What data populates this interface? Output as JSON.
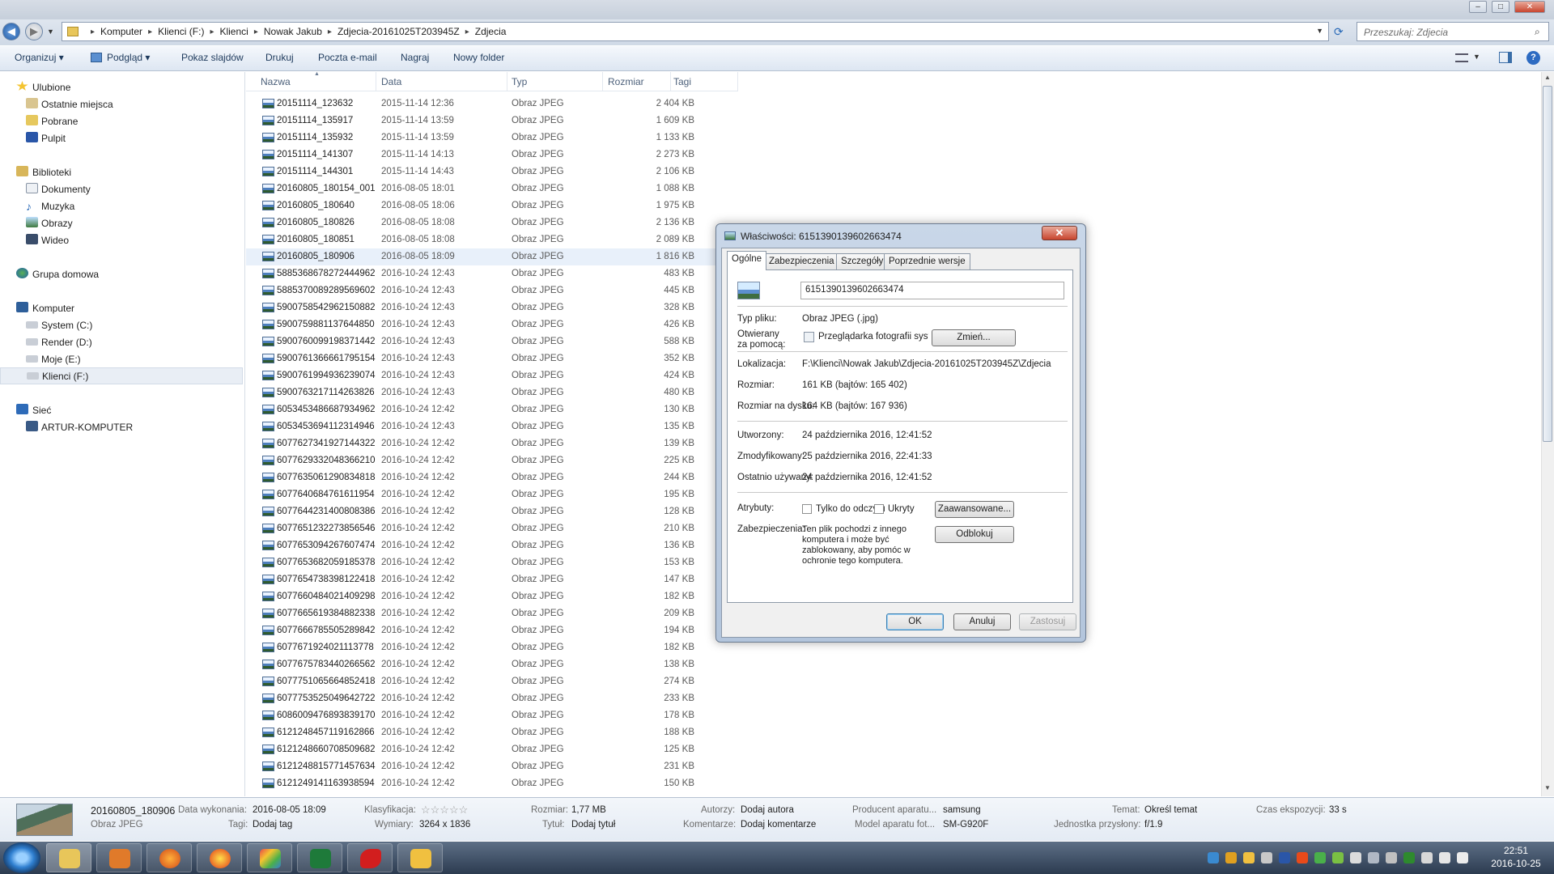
{
  "window": {
    "minimize": "–",
    "maximize": "□",
    "close": "✕"
  },
  "address": {
    "breadcrumbs": [
      "Komputer",
      "Klienci (F:)",
      "Klienci",
      "Nowak Jakub",
      "Zdjecia-20161025T203945Z",
      "Zdjecia"
    ],
    "separator": "▸",
    "search_placeholder": "Przeszukaj: Zdjecia"
  },
  "toolbar": {
    "organize": "Organizuj ▾",
    "preview": "Podgląd ▾",
    "slideshow": "Pokaz slajdów",
    "print": "Drukuj",
    "email": "Poczta e-mail",
    "burn": "Nagraj",
    "new_folder": "Nowy folder"
  },
  "nav": {
    "favorites": "Ulubione",
    "recent": "Ostatnie miejsca",
    "downloads": "Pobrane",
    "desktop": "Pulpit",
    "libraries": "Biblioteki",
    "documents": "Dokumenty",
    "music": "Muzyka",
    "pictures": "Obrazy",
    "videos": "Wideo",
    "homegroup": "Grupa domowa",
    "computer": "Komputer",
    "drive_c": "System (C:)",
    "drive_d": "Render (D:)",
    "drive_e": "Moje (E:)",
    "drive_f": "Klienci (F:)",
    "network": "Sieć",
    "pc": "ARTUR-KOMPUTER"
  },
  "columns": {
    "name": "Nazwa",
    "date": "Data",
    "type": "Typ",
    "size": "Rozmiar",
    "tags": "Tagi"
  },
  "files": [
    {
      "name": "20151114_123632",
      "date": "2015-11-14 12:36",
      "type": "Obraz JPEG",
      "size": "2 404 KB"
    },
    {
      "name": "20151114_135917",
      "date": "2015-11-14 13:59",
      "type": "Obraz JPEG",
      "size": "1 609 KB"
    },
    {
      "name": "20151114_135932",
      "date": "2015-11-14 13:59",
      "type": "Obraz JPEG",
      "size": "1 133 KB"
    },
    {
      "name": "20151114_141307",
      "date": "2015-11-14 14:13",
      "type": "Obraz JPEG",
      "size": "2 273 KB"
    },
    {
      "name": "20151114_144301",
      "date": "2015-11-14 14:43",
      "type": "Obraz JPEG",
      "size": "2 106 KB"
    },
    {
      "name": "20160805_180154_001",
      "date": "2016-08-05 18:01",
      "type": "Obraz JPEG",
      "size": "1 088 KB"
    },
    {
      "name": "20160805_180640",
      "date": "2016-08-05 18:06",
      "type": "Obraz JPEG",
      "size": "1 975 KB"
    },
    {
      "name": "20160805_180826",
      "date": "2016-08-05 18:08",
      "type": "Obraz JPEG",
      "size": "2 136 KB"
    },
    {
      "name": "20160805_180851",
      "date": "2016-08-05 18:08",
      "type": "Obraz JPEG",
      "size": "2 089 KB"
    },
    {
      "name": "20160805_180906",
      "date": "2016-08-05 18:09",
      "type": "Obraz JPEG",
      "size": "1 816 KB"
    },
    {
      "name": "5885368678272444962",
      "date": "2016-10-24 12:43",
      "type": "Obraz JPEG",
      "size": "483 KB"
    },
    {
      "name": "5885370089289569602",
      "date": "2016-10-24 12:43",
      "type": "Obraz JPEG",
      "size": "445 KB"
    },
    {
      "name": "5900758542962150882",
      "date": "2016-10-24 12:43",
      "type": "Obraz JPEG",
      "size": "328 KB"
    },
    {
      "name": "5900759881137644850",
      "date": "2016-10-24 12:43",
      "type": "Obraz JPEG",
      "size": "426 KB"
    },
    {
      "name": "5900760099198371442",
      "date": "2016-10-24 12:43",
      "type": "Obraz JPEG",
      "size": "588 KB"
    },
    {
      "name": "5900761366661795154",
      "date": "2016-10-24 12:43",
      "type": "Obraz JPEG",
      "size": "352 KB"
    },
    {
      "name": "5900761994936239074",
      "date": "2016-10-24 12:43",
      "type": "Obraz JPEG",
      "size": "424 KB"
    },
    {
      "name": "5900763217114263826",
      "date": "2016-10-24 12:43",
      "type": "Obraz JPEG",
      "size": "480 KB"
    },
    {
      "name": "6053453486687934962",
      "date": "2016-10-24 12:42",
      "type": "Obraz JPEG",
      "size": "130 KB"
    },
    {
      "name": "6053453694112314946",
      "date": "2016-10-24 12:43",
      "type": "Obraz JPEG",
      "size": "135 KB"
    },
    {
      "name": "6077627341927144322",
      "date": "2016-10-24 12:42",
      "type": "Obraz JPEG",
      "size": "139 KB"
    },
    {
      "name": "6077629332048366210",
      "date": "2016-10-24 12:42",
      "type": "Obraz JPEG",
      "size": "225 KB"
    },
    {
      "name": "6077635061290834818",
      "date": "2016-10-24 12:42",
      "type": "Obraz JPEG",
      "size": "244 KB"
    },
    {
      "name": "6077640684761611954",
      "date": "2016-10-24 12:42",
      "type": "Obraz JPEG",
      "size": "195 KB"
    },
    {
      "name": "6077644231400808386",
      "date": "2016-10-24 12:42",
      "type": "Obraz JPEG",
      "size": "128 KB"
    },
    {
      "name": "6077651232273856546",
      "date": "2016-10-24 12:42",
      "type": "Obraz JPEG",
      "size": "210 KB"
    },
    {
      "name": "6077653094267607474",
      "date": "2016-10-24 12:42",
      "type": "Obraz JPEG",
      "size": "136 KB"
    },
    {
      "name": "6077653682059185378",
      "date": "2016-10-24 12:42",
      "type": "Obraz JPEG",
      "size": "153 KB"
    },
    {
      "name": "6077654738398122418",
      "date": "2016-10-24 12:42",
      "type": "Obraz JPEG",
      "size": "147 KB"
    },
    {
      "name": "6077660484021409298",
      "date": "2016-10-24 12:42",
      "type": "Obraz JPEG",
      "size": "182 KB"
    },
    {
      "name": "6077665619384882338",
      "date": "2016-10-24 12:42",
      "type": "Obraz JPEG",
      "size": "209 KB"
    },
    {
      "name": "6077666785505289842",
      "date": "2016-10-24 12:42",
      "type": "Obraz JPEG",
      "size": "194 KB"
    },
    {
      "name": "6077671924021113778",
      "date": "2016-10-24 12:42",
      "type": "Obraz JPEG",
      "size": "182 KB"
    },
    {
      "name": "6077675783440266562",
      "date": "2016-10-24 12:42",
      "type": "Obraz JPEG",
      "size": "138 KB"
    },
    {
      "name": "6077751065664852418",
      "date": "2016-10-24 12:42",
      "type": "Obraz JPEG",
      "size": "274 KB"
    },
    {
      "name": "6077753525049642722",
      "date": "2016-10-24 12:42",
      "type": "Obraz JPEG",
      "size": "233 KB"
    },
    {
      "name": "6086009476893839170",
      "date": "2016-10-24 12:42",
      "type": "Obraz JPEG",
      "size": "178 KB"
    },
    {
      "name": "6121248457119162866",
      "date": "2016-10-24 12:42",
      "type": "Obraz JPEG",
      "size": "188 KB"
    },
    {
      "name": "6121248660708509682",
      "date": "2016-10-24 12:42",
      "type": "Obraz JPEG",
      "size": "125 KB"
    },
    {
      "name": "6121248815771457634",
      "date": "2016-10-24 12:42",
      "type": "Obraz JPEG",
      "size": "231 KB"
    },
    {
      "name": "6121249141163938594",
      "date": "2016-10-24 12:42",
      "type": "Obraz JPEG",
      "size": "150 KB"
    }
  ],
  "dialog": {
    "title": "Właściwości: 6151390139602663474",
    "close": "✕",
    "tabs": [
      "Ogólne",
      "Zabezpieczenia",
      "Szczegóły",
      "Poprzednie wersje"
    ],
    "filename": "6151390139602663474",
    "file_type_label": "Typ pliku:",
    "file_type_value": "Obraz JPEG (.jpg)",
    "opens_with_label_1": "Otwierany",
    "opens_with_label_2": "za pomocą:",
    "opens_with_value": "Przeglądarka fotografii systemu Wir",
    "change_button": "Zmień...",
    "location_label": "Lokalizacja:",
    "location_value": "F:\\Klienci\\Nowak Jakub\\Zdjecia-20161025T203945Z\\Zdjecia",
    "size_label": "Rozmiar:",
    "size_value": "161 KB (bajtów: 165 402)",
    "disk_size_label": "Rozmiar na dysku:",
    "disk_size_value": "164 KB (bajtów: 167 936)",
    "created_label": "Utworzony:",
    "created_value": "24 października 2016, 12:41:52",
    "modified_label": "Zmodyfikowany:",
    "modified_value": "25 października 2016, 22:41:33",
    "accessed_label": "Ostatnio używany:",
    "accessed_value": "24 października 2016, 12:41:52",
    "attributes_label": "Atrybuty:",
    "readonly_label": "Tylko do odczytu",
    "hidden_label": "Ukryty",
    "advanced_button": "Zaawansowane...",
    "security_label": "Zabezpieczenia:",
    "security_text_1": "Ten plik pochodzi z innego",
    "security_text_2": "komputera i może być",
    "security_text_3": "zablokowany, aby pomóc w",
    "security_text_4": "ochronie tego komputera.",
    "unblock_button": "Odblokuj",
    "ok": "OK",
    "cancel": "Anuluj",
    "apply": "Zastosuj"
  },
  "details": {
    "name": "20160805_180906",
    "type": "Obraz JPEG",
    "date_taken_label": "Data wykonania:",
    "date_taken_value": "2016-08-05 18:09",
    "tags_label": "Tagi:",
    "tags_value": "Dodaj tag",
    "rating_label": "Klasyfikacja:",
    "rating_value": "☆☆☆☆☆",
    "dimensions_label": "Wymiary:",
    "dimensions_value": "3264 x 1836",
    "size_label": "Rozmiar:",
    "size_value": "1,77 MB",
    "title_label": "Tytuł:",
    "title_value": "Dodaj tytuł",
    "authors_label": "Autorzy:",
    "authors_value": "Dodaj autora",
    "comments_label": "Komentarze:",
    "comments_value": "Dodaj komentarze",
    "maker_label": "Producent aparatu...",
    "maker_value": "samsung",
    "model_label": "Model aparatu fot...",
    "model_value": "SM-G920F",
    "subject_label": "Temat:",
    "subject_value": "Określ temat",
    "fstop_label": "Jednostka przysłony:",
    "fstop_value": "f/1.9",
    "exposure_label": "Czas ekspozycji:",
    "exposure_value": "33 s"
  },
  "taskbar": {
    "time": "22:51",
    "date": "2016-10-25"
  }
}
